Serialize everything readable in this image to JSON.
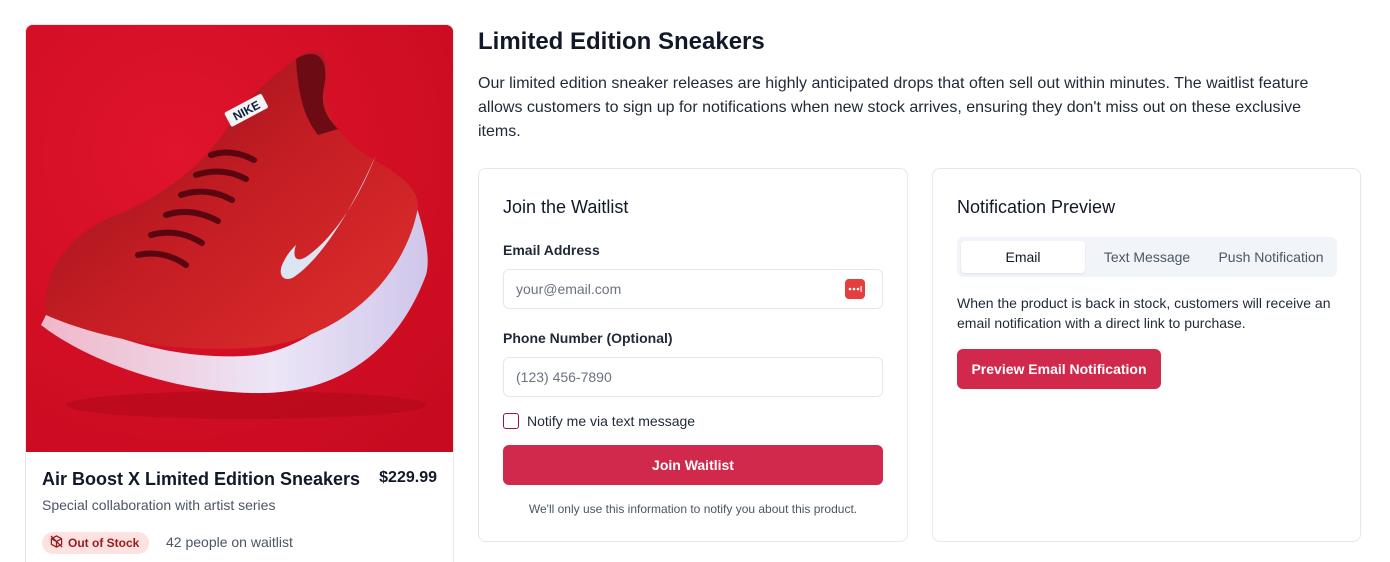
{
  "product": {
    "image_alt": "Red Nike sneaker",
    "brand_mark": "NIKE",
    "name": "Air Boost X Limited Edition Sneakers",
    "price": "$229.99",
    "subtitle": "Special collaboration with artist series",
    "stock_status": "Out of Stock",
    "waitlist_count": "42 people on waitlist",
    "colors": {
      "image_bg": "#d90e25",
      "shoe": "#a3121d",
      "sole": "#e8dff5",
      "swoosh": "#dce6f3"
    }
  },
  "header": {
    "title": "Limited Edition Sneakers",
    "description": "Our limited edition sneaker releases are highly anticipated drops that often sell out within minutes. The waitlist feature allows customers to sign up for notifications when new stock arrives, ensuring they don't miss out on these exclusive items."
  },
  "waitlist_form": {
    "title": "Join the Waitlist",
    "email_label": "Email Address",
    "email_placeholder": "your@email.com",
    "email_value": "",
    "phone_label": "Phone Number (Optional)",
    "phone_placeholder": "(123) 456-7890",
    "phone_value": "",
    "sms_checkbox_label": "Notify me via text message",
    "sms_checked": false,
    "submit_label": "Join Waitlist",
    "disclaimer": "We'll only use this information to notify you about this product."
  },
  "notification_preview": {
    "title": "Notification Preview",
    "tabs": [
      {
        "label": "Email",
        "active": true
      },
      {
        "label": "Text Message",
        "active": false
      },
      {
        "label": "Push Notification",
        "active": false
      }
    ],
    "description": "When the product is back in stock, customers will receive an email notification with a direct link to purchase.",
    "button_label": "Preview Email Notification"
  },
  "theme": {
    "accent": "#d1294c",
    "badge_bg": "#fee2e2",
    "badge_text": "#991b1b"
  }
}
